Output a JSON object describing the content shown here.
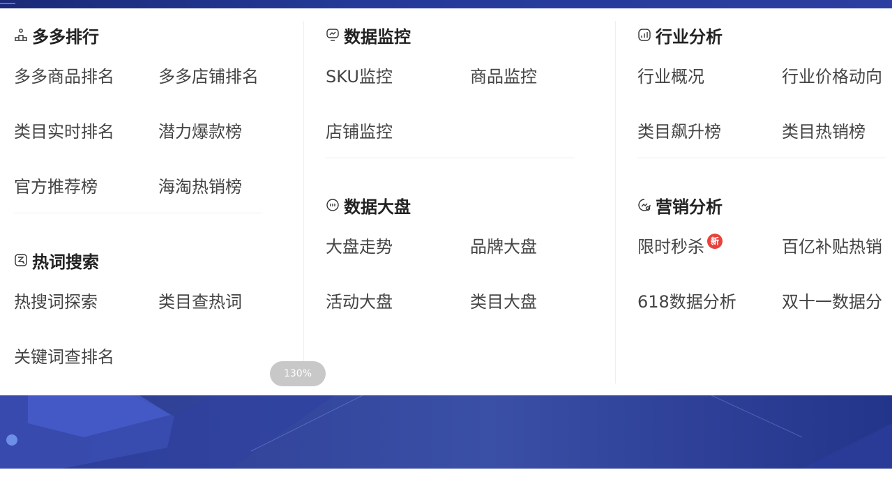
{
  "colors": {
    "text": "#444444",
    "title": "#222222",
    "badge": "#e8423b",
    "banner": "#33469c"
  },
  "ranking": {
    "title": "多多排行",
    "icon": "rank-podium-icon",
    "items": [
      "多多商品排名",
      "多多店铺排名",
      "类目实时排名",
      "潜力爆款榜",
      "官方推荐榜",
      "海淘热销榜"
    ]
  },
  "hotwords": {
    "title": "热词搜索",
    "icon": "search-box-icon",
    "items": [
      "热搜词探索",
      "类目查热词",
      "关键词查排名"
    ]
  },
  "monitor": {
    "title": "数据监控",
    "icon": "monitor-chat-icon",
    "items": [
      "SKU监控",
      "商品监控",
      "店铺监控"
    ]
  },
  "market": {
    "title": "数据大盘",
    "icon": "dots-box-icon",
    "items": [
      "大盘走势",
      "品牌大盘",
      "活动大盘",
      "类目大盘"
    ]
  },
  "industry": {
    "title": "行业分析",
    "icon": "chart-box-icon",
    "items": [
      "行业概况",
      "行业价格动向",
      "类目飙升榜",
      "类目热销榜"
    ]
  },
  "marketing": {
    "title": "营销分析",
    "icon": "marketing-chart-icon",
    "items": [
      "限时秒杀",
      "百亿补贴热销",
      "618数据分析",
      "双十一数据分"
    ],
    "badge_new": "新"
  },
  "zoom": "130%"
}
